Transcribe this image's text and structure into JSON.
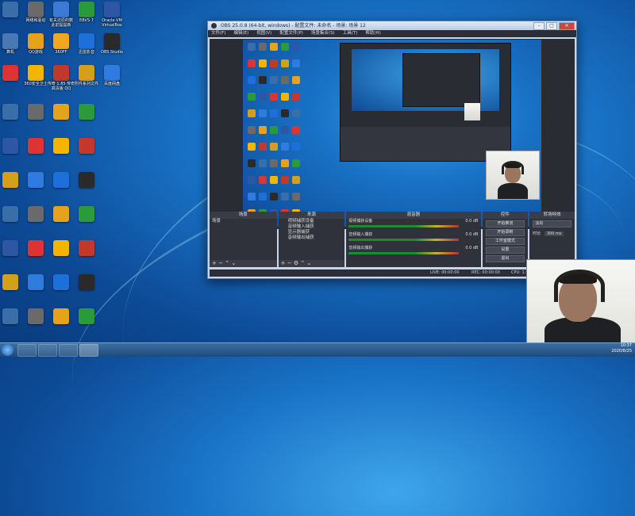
{
  "desktop": {
    "icons": [
      {
        "label": "",
        "color": "#3a6ea8",
        "x": 0,
        "y": 2
      },
      {
        "label": "网络和驱动",
        "color": "#6a6a6a",
        "x": 1,
        "y": 2
      },
      {
        "label": "有关还原的数\n此前提提新",
        "color": "#3b7bd6",
        "x": 2,
        "y": 2
      },
      {
        "label": "EBVS 7",
        "color": "#2b9a3a",
        "x": 3,
        "y": 2
      },
      {
        "label": "Oracle VM\nVirtualBox",
        "color": "#2d57a5",
        "x": 4,
        "y": 2
      },
      {
        "label": "算机",
        "color": "#4a78b5",
        "x": 0,
        "y": 1
      },
      {
        "label": "QQ游戏",
        "color": "#e6a21a",
        "x": 1,
        "y": 1
      },
      {
        "label": "360FF",
        "color": "#f2a81d",
        "x": 2,
        "y": 1
      },
      {
        "label": "迅雷影音",
        "color": "#1d6fd9",
        "x": 3,
        "y": 1
      },
      {
        "label": "OBS Studio",
        "color": "#2a2a2a",
        "x": 4,
        "y": 1
      },
      {
        "label": "",
        "color": "#d33",
        "x": 0,
        "y": 0
      },
      {
        "label": "360安全卫士",
        "color": "#f4b400",
        "x": 1,
        "y": 0
      },
      {
        "label": "传奇 1.85 传奇\n高清版 QQ",
        "color": "#c0392b",
        "x": 2,
        "y": 0
      },
      {
        "label": "附件系列文件",
        "color": "#d4a019",
        "x": 3,
        "y": 0
      },
      {
        "label": "百度网盘",
        "color": "#2f7be0",
        "x": 4,
        "y": 0
      }
    ]
  },
  "obs": {
    "title": "OBS 25.0.8 (64-bit, windows) - 配置文件: 未命名 - 场景: 场景 12",
    "menu": [
      "文件(F)",
      "编辑(E)",
      "视图(V)",
      "配置文件(P)",
      "场景集合(S)",
      "工具(T)",
      "帮助(H)"
    ],
    "docks": {
      "scenes": {
        "title": "场景",
        "items": [
          "场景"
        ]
      },
      "sources": {
        "title": "来源",
        "items": [
          "视频捕获设备",
          "音频输入捕获",
          "显示器捕获",
          "音频输出捕获"
        ]
      },
      "mixer": {
        "title": "混音器",
        "channels": [
          {
            "name": "视频捕获设备",
            "db": "0.0 dB"
          },
          {
            "name": "音频输入捕获",
            "db": "0.0 dB"
          },
          {
            "name": "音频输出捕获",
            "db": "0.0 dB"
          }
        ]
      },
      "transitions": {
        "title": "转场特效",
        "type": "淡出",
        "duration_label": "时长",
        "duration": "300 ms"
      },
      "controls": {
        "title": "控件",
        "buttons": [
          "开始推流",
          "开始录制",
          "工作室模式",
          "设置",
          "退出"
        ]
      }
    },
    "status": {
      "live": "LIVE: 00:00:00",
      "rec": "REC: 00:00:00",
      "cpu": "CPU: 1.5%, 30.00 fps"
    }
  },
  "taskbar": {
    "time": "10:37",
    "date": "2020/8/25"
  }
}
